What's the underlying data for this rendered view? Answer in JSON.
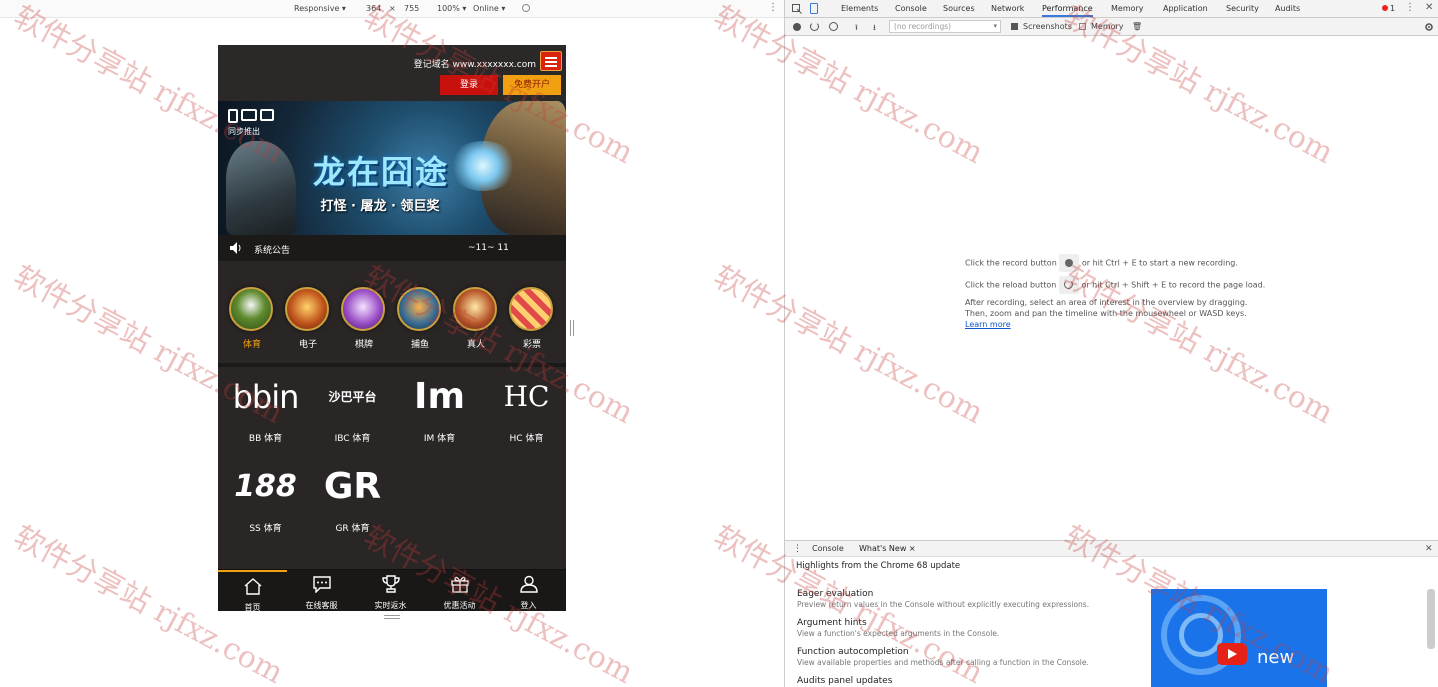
{
  "emulation_toolbar": {
    "device": "Responsive ▾",
    "width": "364",
    "times": "×",
    "height": "755",
    "zoom": "100% ▾",
    "network": "Online ▾"
  },
  "phone": {
    "domain_note": "登记域名 www.xxxxxxx.com",
    "login_label": "登录",
    "register_label": "免费开户",
    "banner": {
      "sync_label": "同步推出",
      "title": "龙在囧途",
      "subtitle": "打怪 · 屠龙 · 领巨奖"
    },
    "notice": {
      "label": "系统公告",
      "text": "~11~ 11"
    },
    "games": [
      {
        "label": "体育",
        "active": true
      },
      {
        "label": "电子"
      },
      {
        "label": "棋牌"
      },
      {
        "label": "捕鱼"
      },
      {
        "label": "真人"
      },
      {
        "label": "彩票"
      }
    ],
    "brands": [
      {
        "logo": "bbin",
        "label": "BB 体育"
      },
      {
        "logo": "沙巴平台",
        "label": "IBC 体育"
      },
      {
        "logo": "Im",
        "label": "IM 体育"
      },
      {
        "logo": "HC",
        "label": "HC 体育"
      },
      {
        "logo": "188",
        "label": "SS 体育"
      },
      {
        "logo": "GR",
        "label": "GR 体育"
      }
    ],
    "tabs": [
      {
        "label": "首页",
        "icon": "home-icon"
      },
      {
        "label": "在线客服",
        "icon": "chat-icon"
      },
      {
        "label": "实时返水",
        "icon": "trophy-icon"
      },
      {
        "label": "优惠活动",
        "icon": "gift-icon"
      },
      {
        "label": "登入",
        "icon": "user-icon"
      }
    ]
  },
  "devtools": {
    "tabs": [
      "Elements",
      "Console",
      "Sources",
      "Network",
      "Performance",
      "Memory",
      "Application",
      "Security",
      "Audits"
    ],
    "active_tab": "Performance",
    "error_count": "1",
    "toolbar": {
      "url_placeholder": "(no recordings)",
      "screenshots_label": "Screenshots",
      "memory_label": "Memory"
    },
    "perf_message": {
      "line1_a": "Click the record button",
      "line1_b": "or hit Ctrl + E to start a new recording.",
      "line2_a": "Click the reload button",
      "line2_b": "or hit Ctrl + Shift + E to record the page load.",
      "line3": "After recording, select an area of interest in the overview by dragging.",
      "line4": "Then, zoom and pan the timeline with the mousewheel or WASD keys.",
      "learn_more": "Learn more"
    },
    "drawer": {
      "tab_console": "Console",
      "tab_whats_new": "What's New ×",
      "heading": "Highlights from the Chrome 68 update",
      "items": [
        {
          "title": "Eager evaluation",
          "desc": "Preview return values in the Console without explicitly executing expressions."
        },
        {
          "title": "Argument hints",
          "desc": "View a function's expected arguments in the Console."
        },
        {
          "title": "Function autocompletion",
          "desc": "View available properties and methods after calling a function in the Console."
        },
        {
          "title": "Audits panel updates",
          "desc": ""
        }
      ],
      "video_new": "new"
    }
  },
  "watermark": "软件分享站 rjfxz.com",
  "colors": {
    "phone_bg": "#2a2625",
    "login_red": "#c8110c",
    "register_orange": "#f0a010",
    "accent_blue": "#3879d9"
  }
}
